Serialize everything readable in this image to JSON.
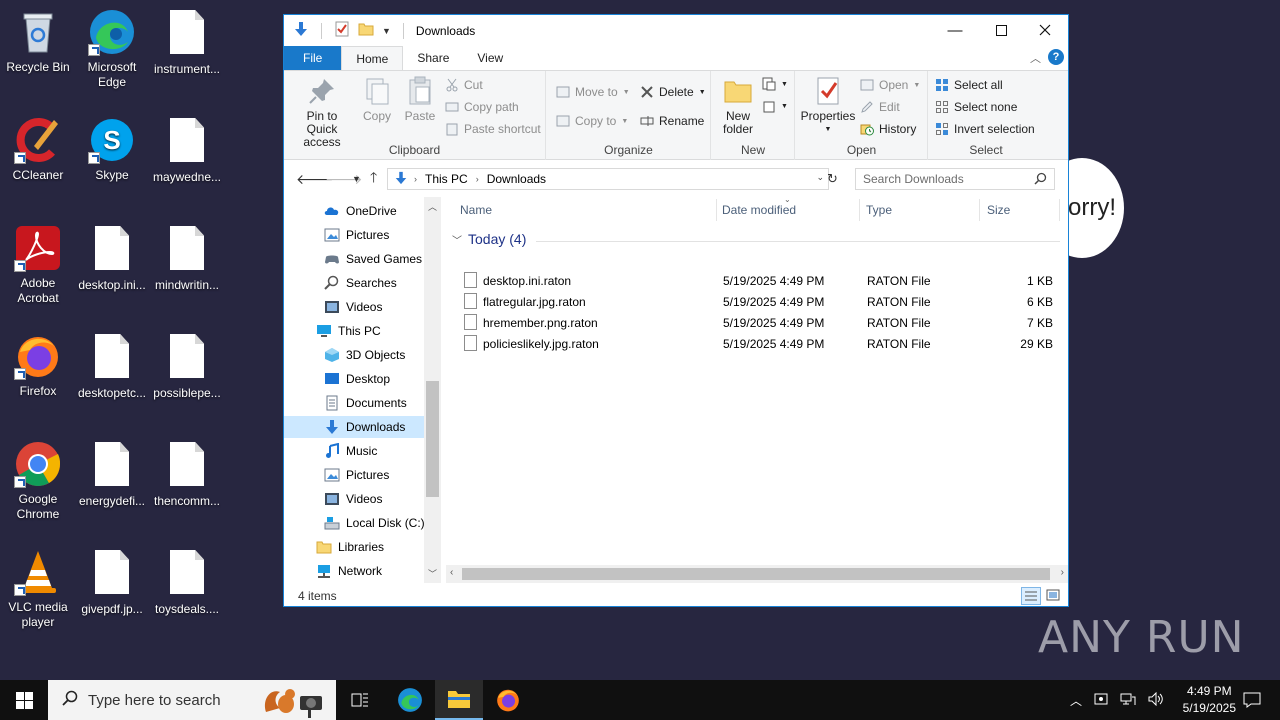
{
  "desktop": {
    "icons": [
      {
        "label": "Recycle Bin"
      },
      {
        "label": "Microsoft Edge"
      },
      {
        "label": "instrument..."
      },
      {
        "label": "CCleaner"
      },
      {
        "label": "Skype"
      },
      {
        "label": "maywedne..."
      },
      {
        "label": "Adobe Acrobat"
      },
      {
        "label": "desktop.ini..."
      },
      {
        "label": "mindwritin..."
      },
      {
        "label": "Firefox"
      },
      {
        "label": "desktopetc..."
      },
      {
        "label": "possiblepe..."
      },
      {
        "label": "Google Chrome"
      },
      {
        "label": "energydefi..."
      },
      {
        "label": "thencomm..."
      },
      {
        "label": "VLC media player"
      },
      {
        "label": "givepdf.jp..."
      },
      {
        "label": "toysdeals...."
      }
    ]
  },
  "window": {
    "title": "Downloads",
    "tabs": [
      "File",
      "Home",
      "Share",
      "View"
    ],
    "ribbon": {
      "clipboard": {
        "label": "Clipboard",
        "pin": "Pin to Quick access",
        "copy": "Copy",
        "paste": "Paste",
        "cut": "Cut",
        "copy_path": "Copy path",
        "paste_shortcut": "Paste shortcut"
      },
      "organize": {
        "label": "Organize",
        "move_to": "Move to",
        "copy_to": "Copy to",
        "delete": "Delete",
        "rename": "Rename"
      },
      "new": {
        "label": "New",
        "new_folder": "New folder"
      },
      "open": {
        "label": "Open",
        "properties": "Properties",
        "open": "Open",
        "edit": "Edit",
        "history": "History"
      },
      "select": {
        "label": "Select",
        "select_all": "Select all",
        "select_none": "Select none",
        "invert": "Invert selection"
      }
    },
    "address": {
      "crumbs": [
        "This PC",
        "Downloads"
      ]
    },
    "search": {
      "placeholder": "Search Downloads"
    },
    "nav": [
      {
        "label": "OneDrive",
        "icon": "onedrive-icon"
      },
      {
        "label": "Pictures",
        "icon": "pictures-icon"
      },
      {
        "label": "Saved Games",
        "icon": "saved-games-icon"
      },
      {
        "label": "Searches",
        "icon": "searches-icon"
      },
      {
        "label": "Videos",
        "icon": "videos-icon"
      },
      {
        "label": "This PC",
        "icon": "this-pc-icon"
      },
      {
        "label": "3D Objects",
        "icon": "3d-objects-icon"
      },
      {
        "label": "Desktop",
        "icon": "desktop-icon"
      },
      {
        "label": "Documents",
        "icon": "documents-icon"
      },
      {
        "label": "Downloads",
        "icon": "downloads-icon"
      },
      {
        "label": "Music",
        "icon": "music-icon"
      },
      {
        "label": "Pictures",
        "icon": "pictures-icon"
      },
      {
        "label": "Videos",
        "icon": "videos-icon"
      },
      {
        "label": "Local Disk (C:)",
        "icon": "drive-icon"
      },
      {
        "label": "Libraries",
        "icon": "libraries-icon"
      },
      {
        "label": "Network",
        "icon": "network-icon"
      }
    ],
    "columns": [
      "Name",
      "Date modified",
      "Type",
      "Size"
    ],
    "group": "Today (4)",
    "files": [
      {
        "name": "desktop.ini.raton",
        "date": "5/19/2025 4:49 PM",
        "type": "RATON File",
        "size": "1 KB"
      },
      {
        "name": "flatregular.jpg.raton",
        "date": "5/19/2025 4:49 PM",
        "type": "RATON File",
        "size": "6 KB"
      },
      {
        "name": "hremember.png.raton",
        "date": "5/19/2025 4:49 PM",
        "type": "RATON File",
        "size": "7 KB"
      },
      {
        "name": "policieslikely.jpg.raton",
        "date": "5/19/2025 4:49 PM",
        "type": "RATON File",
        "size": "29 KB"
      }
    ],
    "status": "4 items"
  },
  "bubble_text": "orry!",
  "watermark": "ANY RUN",
  "taskbar": {
    "search_placeholder": "Type here to search",
    "time": "4:49 PM",
    "date": "5/19/2025"
  }
}
